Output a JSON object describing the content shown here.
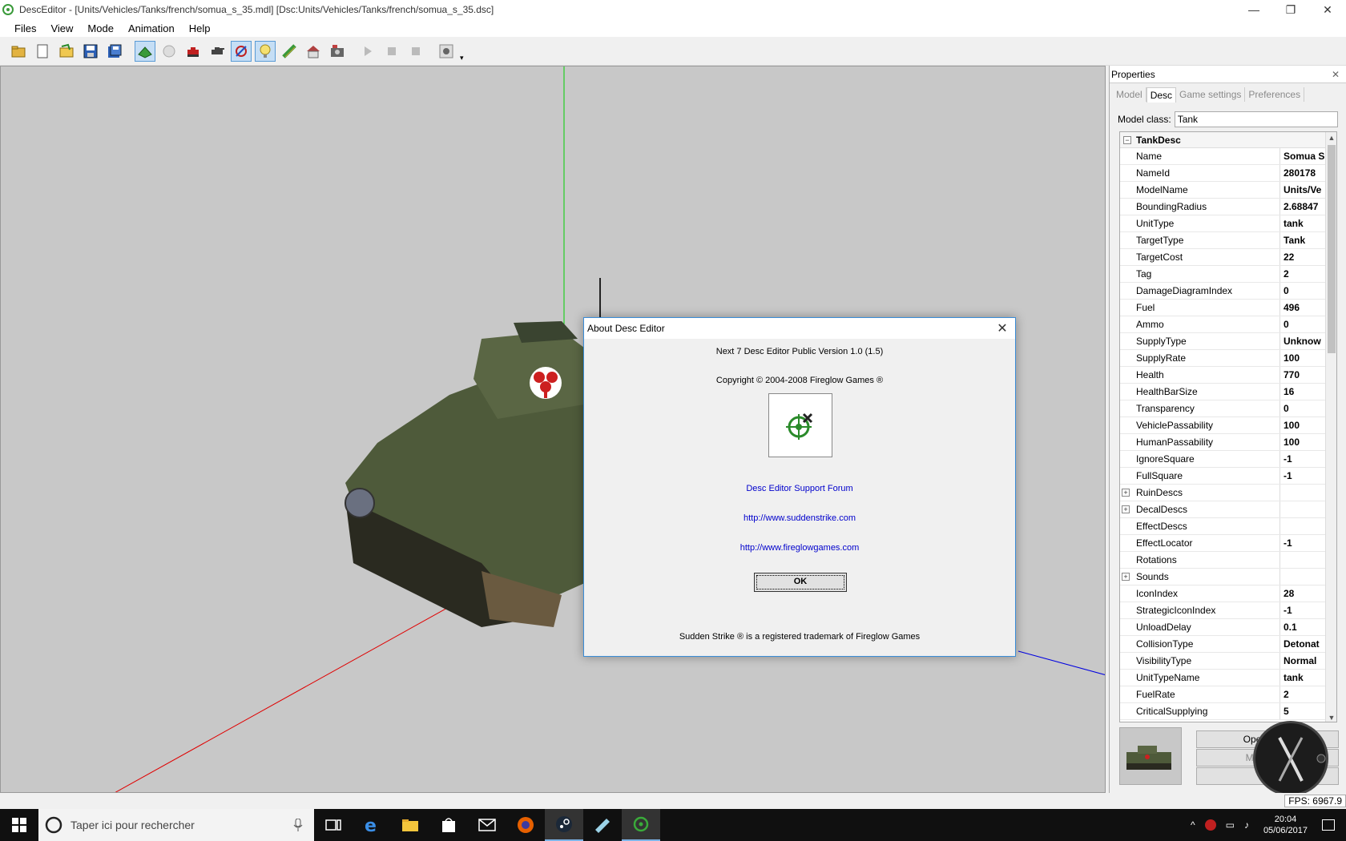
{
  "window": {
    "title": "DescEditor - [Units/Vehicles/Tanks/french/somua_s_35.mdl] [Dsc:Units/Vehicles/Tanks/french/somua_s_35.dsc]",
    "minimize": "—",
    "maximize": "❐",
    "close": "✕"
  },
  "menu": {
    "files": "Files",
    "view": "View",
    "mode": "Mode",
    "animation": "Animation",
    "help": "Help"
  },
  "properties": {
    "title": "Properties",
    "close": "✕",
    "tabs": [
      "Model",
      "Desc",
      "Game settings",
      "Preferences"
    ],
    "active_tab": "Desc",
    "model_class_label": "Model class:",
    "model_class_value": "Tank",
    "group": "TankDesc",
    "rows": [
      {
        "k": "Name",
        "v": "Somua S"
      },
      {
        "k": "NameId",
        "v": "280178"
      },
      {
        "k": "ModelName",
        "v": "Units/Ve"
      },
      {
        "k": "BoundingRadius",
        "v": "2.68847"
      },
      {
        "k": "UnitType",
        "v": "tank"
      },
      {
        "k": "TargetType",
        "v": "Tank"
      },
      {
        "k": "TargetCost",
        "v": "22"
      },
      {
        "k": "Tag",
        "v": "2"
      },
      {
        "k": "DamageDiagramIndex",
        "v": "0"
      },
      {
        "k": "Fuel",
        "v": "496"
      },
      {
        "k": "Ammo",
        "v": "0"
      },
      {
        "k": "SupplyType",
        "v": "Unknow"
      },
      {
        "k": "SupplyRate",
        "v": "100"
      },
      {
        "k": "Health",
        "v": "770"
      },
      {
        "k": "HealthBarSize",
        "v": "16"
      },
      {
        "k": "Transparency",
        "v": "0"
      },
      {
        "k": "VehiclePassability",
        "v": "100"
      },
      {
        "k": "HumanPassability",
        "v": "100"
      },
      {
        "k": "IgnoreSquare",
        "v": "-1"
      },
      {
        "k": "FullSquare",
        "v": "-1"
      },
      {
        "k": "RuinDescs",
        "v": "",
        "exp": "+"
      },
      {
        "k": "DecalDescs",
        "v": "",
        "exp": "+"
      },
      {
        "k": "EffectDescs",
        "v": ""
      },
      {
        "k": "EffectLocator",
        "v": "-1"
      },
      {
        "k": "Rotations",
        "v": ""
      },
      {
        "k": "Sounds",
        "v": "",
        "exp": "+"
      },
      {
        "k": "IconIndex",
        "v": "28"
      },
      {
        "k": "StrategicIconIndex",
        "v": "-1"
      },
      {
        "k": "UnloadDelay",
        "v": "0.1"
      },
      {
        "k": "CollisionType",
        "v": "Detonat"
      },
      {
        "k": "VisibilityType",
        "v": "Normal"
      },
      {
        "k": "UnitTypeName",
        "v": "tank"
      },
      {
        "k": "FuelRate",
        "v": "2"
      },
      {
        "k": "CriticalSupplying",
        "v": "5"
      }
    ],
    "btn_open": "Open selec",
    "btn_make_icon": "Make icon",
    "btn_load": "Loa"
  },
  "dialog": {
    "title": "About Desc Editor",
    "close": "✕",
    "version": "Next 7 Desc Editor Public Version 1.0 (1.5)",
    "copyright": "Copyright © 2004-2008 Fireglow Games ®",
    "forum_link": "Desc Editor Support Forum",
    "link1": "http://www.suddenstrike.com",
    "link2": "http://www.fireglowgames.com",
    "ok": "OK",
    "trademark": "Sudden Strike ® is a registered trademark of Fireglow Games"
  },
  "status": {
    "fps": "FPS: 6967.9"
  },
  "taskbar": {
    "search_placeholder": "Taper ici pour rechercher",
    "time": "20:04",
    "date": "05/06/2017"
  }
}
